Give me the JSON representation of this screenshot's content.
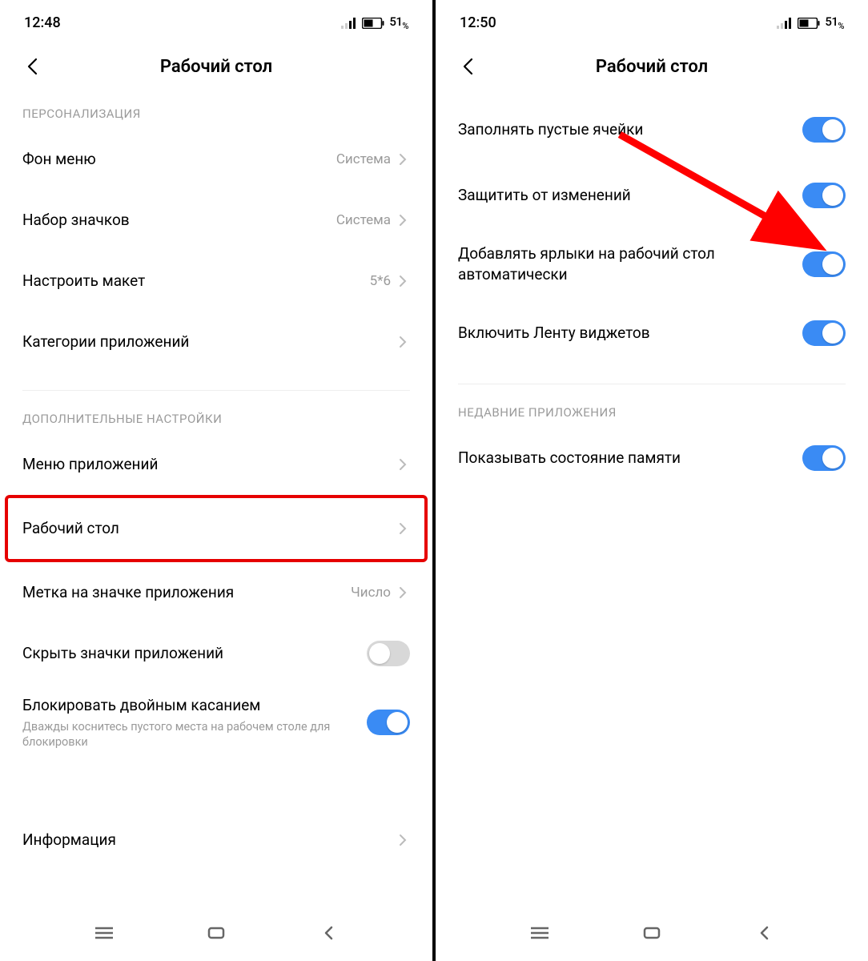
{
  "left": {
    "status": {
      "time": "12:48",
      "battery": "51"
    },
    "title": "Рабочий стол",
    "sections": {
      "personalization": {
        "header": "ПЕРСОНАЛИЗАЦИЯ",
        "items": [
          {
            "label": "Фон меню",
            "value": "Система"
          },
          {
            "label": "Набор значков",
            "value": "Система"
          },
          {
            "label": "Настроить макет",
            "value": "5*6"
          },
          {
            "label": "Категории приложений",
            "value": ""
          }
        ]
      },
      "additional": {
        "header": "ДОПОЛНИТЕЛЬНЫЕ НАСТРОЙКИ",
        "items": [
          {
            "label": "Меню приложений"
          },
          {
            "label": "Рабочий стол"
          },
          {
            "label": "Метка на значке приложения",
            "value": "Число"
          },
          {
            "label": "Скрыть значки приложений",
            "toggle": false
          },
          {
            "label": "Блокировать двойным касанием",
            "sub": "Дважды коснитесь пустого места на рабочем столе для блокировки",
            "toggle": true
          },
          {
            "label": "Информация"
          }
        ]
      }
    }
  },
  "right": {
    "status": {
      "time": "12:50",
      "battery": "51"
    },
    "title": "Рабочий стол",
    "items": [
      {
        "label": "Заполнять пустые ячейки",
        "toggle": true
      },
      {
        "label": "Защитить от изменений",
        "toggle": true
      },
      {
        "label": "Добавлять ярлыки на рабочий стол автоматически",
        "toggle": true
      },
      {
        "label": "Включить Ленту виджетов",
        "toggle": true
      }
    ],
    "recent": {
      "header": "НЕДАВНИЕ ПРИЛОЖЕНИЯ",
      "items": [
        {
          "label": "Показывать состояние памяти",
          "toggle": true
        }
      ]
    }
  },
  "colors": {
    "accent": "#3a8bf4",
    "highlight": "#e60000",
    "arrow": "#ff0000",
    "muted": "#9a9a9a"
  }
}
